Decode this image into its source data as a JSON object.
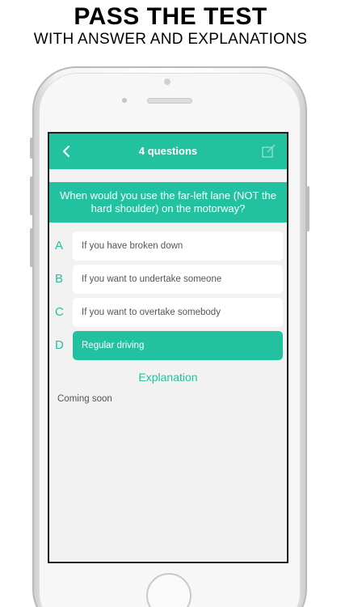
{
  "promo": {
    "headline": "PASS THE TEST",
    "subheadline": "WITH ANSWER AND EXPLANATIONS"
  },
  "navbar": {
    "title": "4 questions",
    "back_icon": "chevron-left-icon",
    "edit_icon": "edit-icon"
  },
  "question": {
    "text": "When would you use the far-left lane (NOT the hard shoulder) on the motorway?"
  },
  "options": [
    {
      "letter": "A",
      "text": "If you have broken down",
      "selected": false
    },
    {
      "letter": "B",
      "text": "If you want to undertake someone",
      "selected": false
    },
    {
      "letter": "C",
      "text": "If you want to overtake somebody",
      "selected": false
    },
    {
      "letter": "D",
      "text": "Regular driving",
      "selected": true
    }
  ],
  "explanation": {
    "title": "Explanation",
    "text": "Coming soon"
  },
  "colors": {
    "accent": "#22c1a0",
    "background": "#f2f2f2",
    "card": "#ffffff"
  }
}
